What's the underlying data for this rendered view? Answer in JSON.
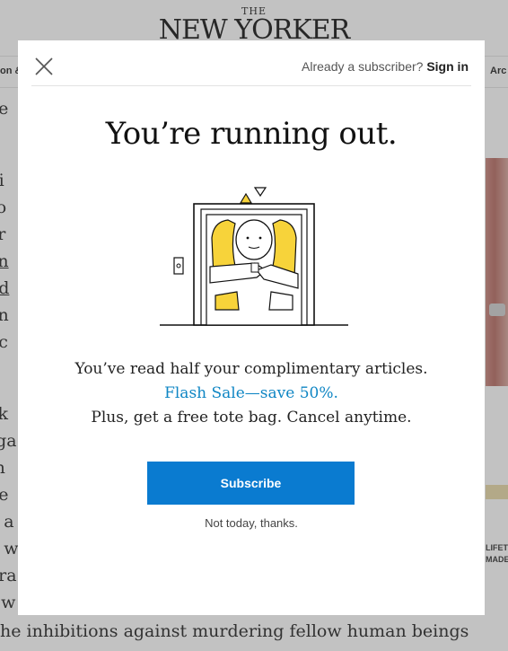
{
  "background": {
    "masthead_the": "THE",
    "masthead_name": "NEW YORKER",
    "nav_left": "on &",
    "nav_right": "Arc",
    "article_lines": [
      "pe",
      "Li",
      "so",
      "er",
      "an",
      "nd",
      "on",
      "uc",
      "ok",
      "rga",
      "th",
      "he",
      "d a",
      "d w",
      "gra",
      "r w"
    ],
    "article_bottom": "he inhibitions against murdering fellow human beings",
    "article_bottom2": "",
    "side_ad_text": [
      "LIFET",
      "MADE"
    ]
  },
  "modal": {
    "close_icon": "close-icon",
    "already_text": "Already a subscriber?",
    "signin_label": "Sign in",
    "headline": "You’re running out.",
    "illustration_icon": "person-in-elevator-illustration",
    "message_line1": "You’ve read half your complimentary articles.",
    "message_line2": "Flash Sale—save 50%.",
    "message_line3": "Plus, get a free tote bag. Cancel anytime.",
    "subscribe_label": "Subscribe",
    "not_today_label": "Not today, thanks."
  },
  "colors": {
    "accent_blue": "#0a7bd0",
    "flash_sale_blue": "#0f86c4",
    "illustration_yellow": "#f7d33a"
  }
}
